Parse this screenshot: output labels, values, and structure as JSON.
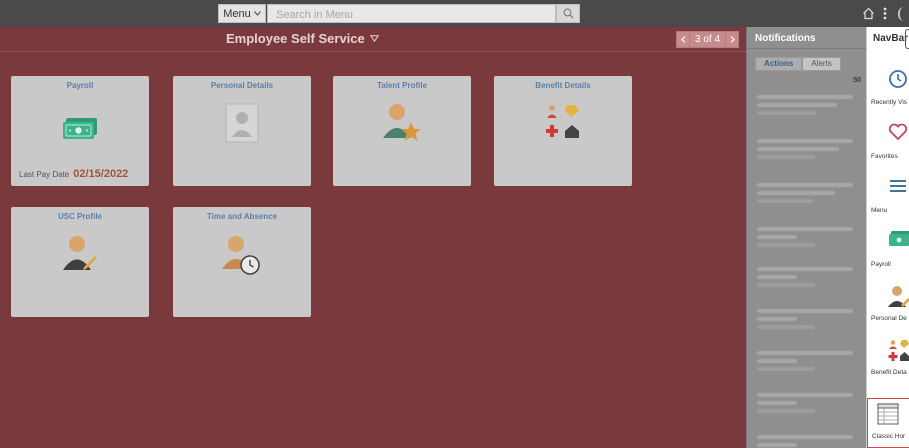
{
  "topbar": {
    "menu_label": "Menu",
    "search_placeholder": "Search in Menu",
    "icons": [
      "chevron-down-icon",
      "search-icon",
      "home-icon",
      "more-vertical-icon"
    ]
  },
  "header": {
    "title": "Employee Self Service",
    "pager_text": "3 of 4"
  },
  "tiles": [
    {
      "title": "Payroll",
      "icon": "cash-icon",
      "foot_label": "Last Pay Date",
      "foot_value": "02/15/2022"
    },
    {
      "title": "Personal Details",
      "icon": "person-placeholder-icon"
    },
    {
      "title": "Talent Profile",
      "icon": "person-star-icon"
    },
    {
      "title": "Benefit Details",
      "icon": "benefits-icon"
    },
    {
      "title": "USC Profile",
      "icon": "person-pencil-icon"
    },
    {
      "title": "Time and Absence",
      "icon": "person-clock-icon"
    }
  ],
  "notifications": {
    "title": "Notifications",
    "tabs": [
      {
        "label": "Actions",
        "active": true
      },
      {
        "label": "Alerts",
        "active": false
      }
    ],
    "count": "50"
  },
  "navbar": {
    "title": "NavBar",
    "items": [
      {
        "label": "Recently Vis",
        "icon": "clock-icon"
      },
      {
        "label": "Favorites",
        "icon": "heart-icon"
      },
      {
        "label": "Menu",
        "icon": "menu-icon"
      },
      {
        "label": "Payroll",
        "icon": "cash-icon"
      },
      {
        "label": "Personal De",
        "icon": "person-pencil-icon"
      },
      {
        "label": "Benefit Deta",
        "icon": "benefits-icon"
      },
      {
        "label": "Classic Hor",
        "icon": "classic-home-icon",
        "highlighted": true
      }
    ]
  },
  "colors": {
    "page_bg": "#7a3a3d",
    "tile_bg": "#c9c9c9",
    "tile_title": "#5b7faa",
    "pay_date": "#a0543d",
    "notif_bg": "#8f8f8f"
  }
}
